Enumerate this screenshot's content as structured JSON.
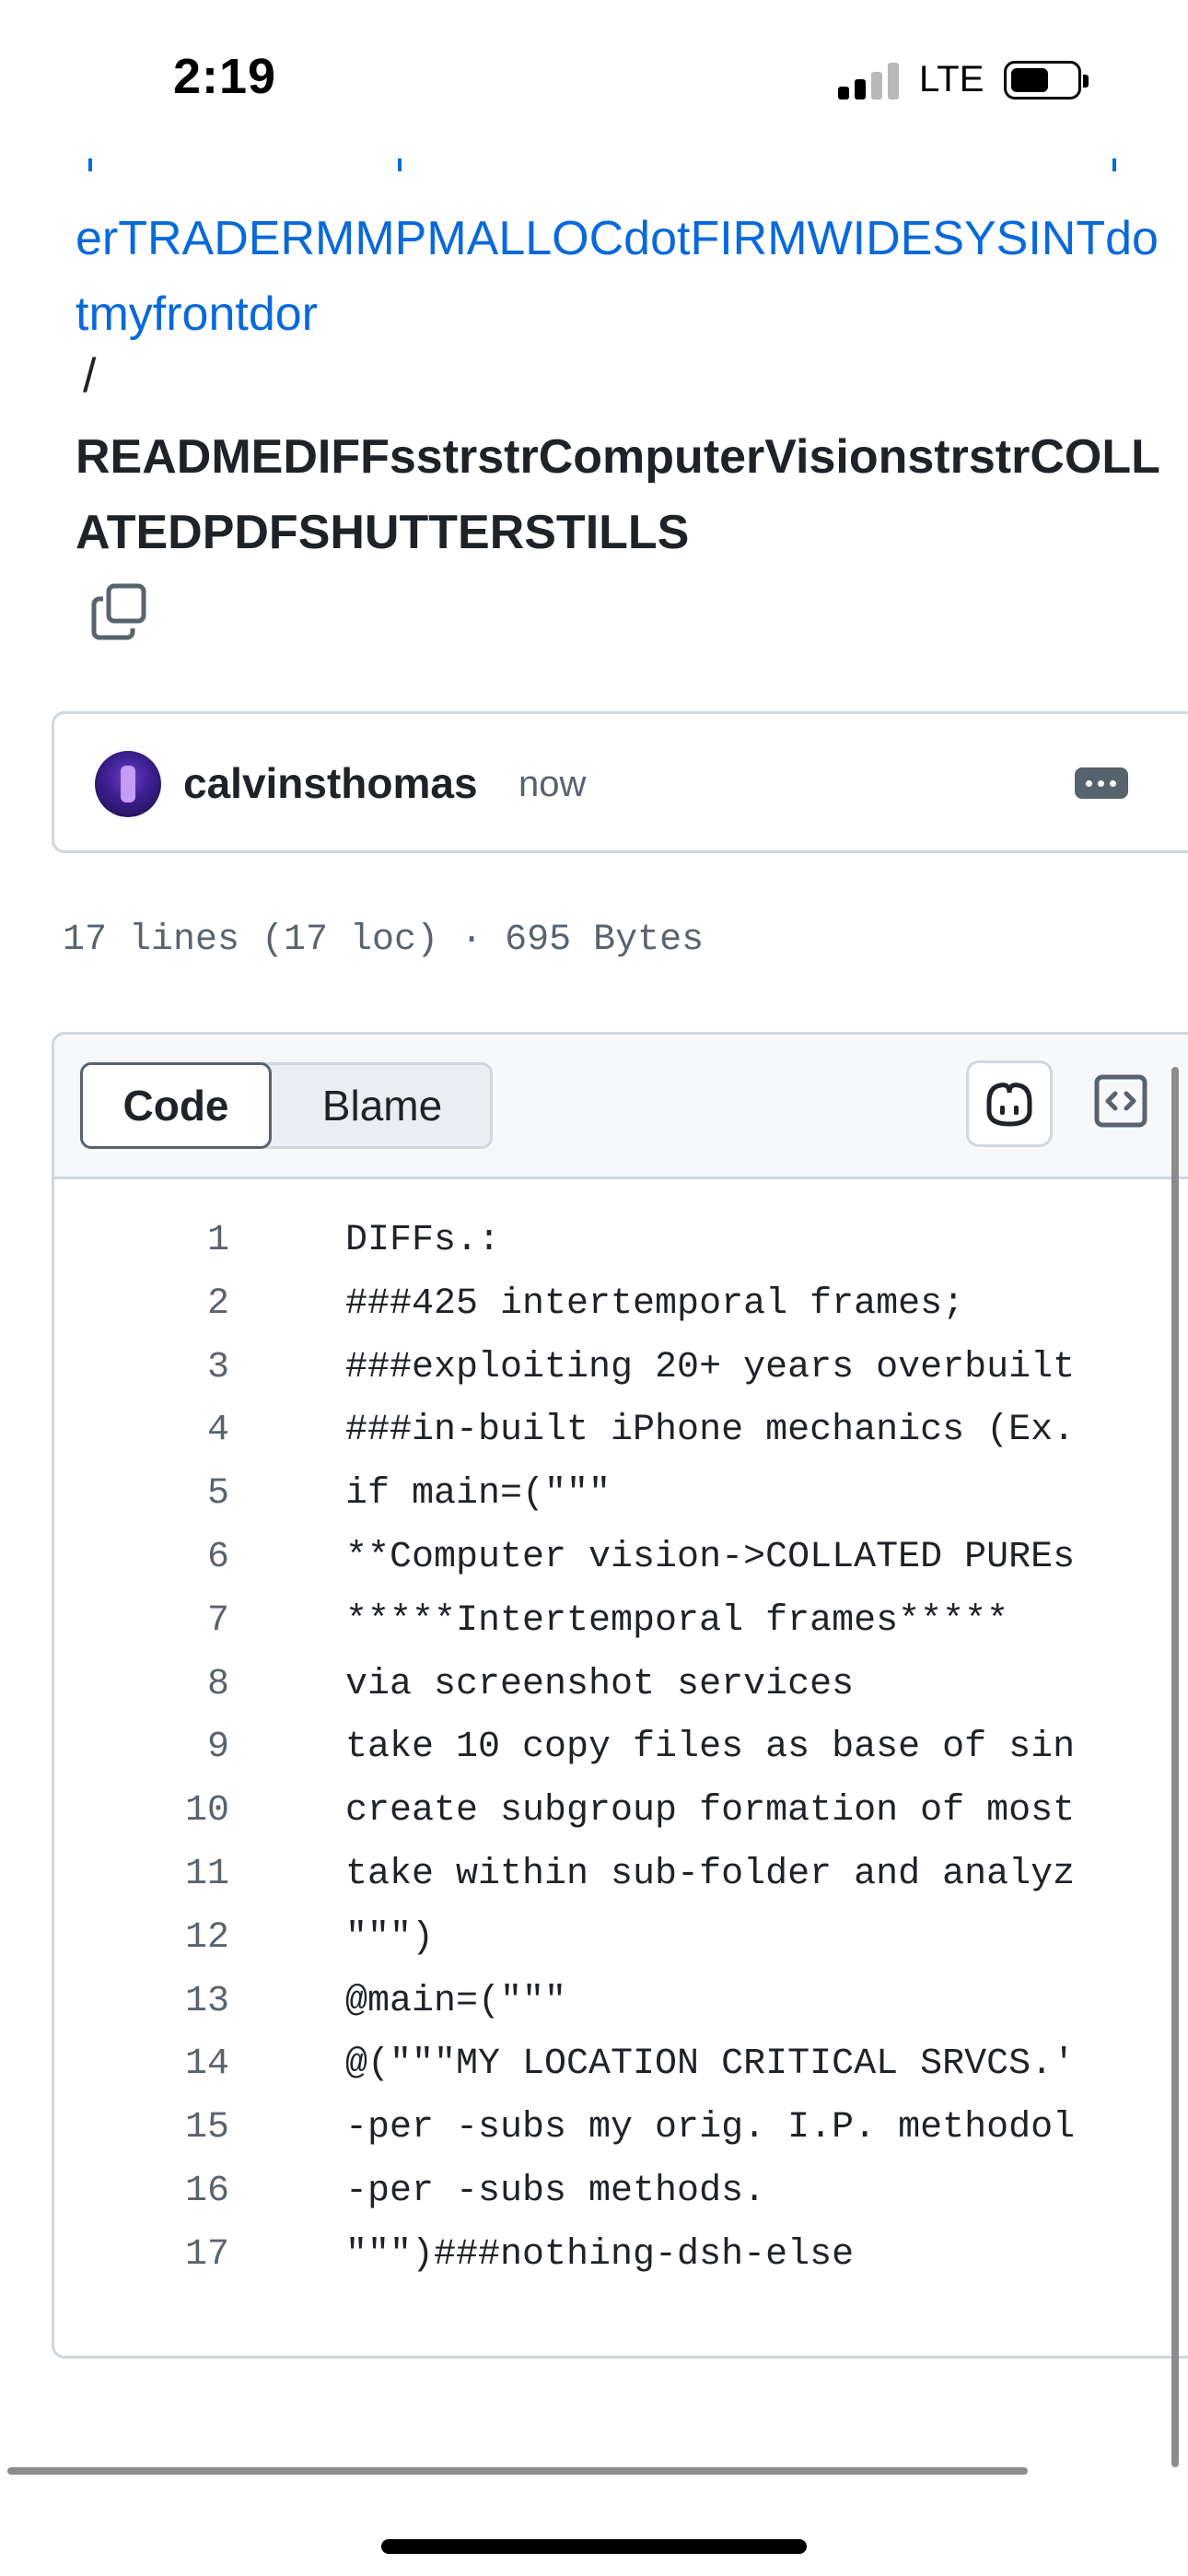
{
  "status_bar": {
    "time": "2:19",
    "network": "LTE"
  },
  "breadcrumb": {
    "repo_path": "erTRADERMMPMALLOCdotFIRMWIDESYSINTdotmyfrontdor",
    "separator": "/",
    "file_name": "READMEDIFFsstrstrComputerVisionstrstrCOLLATEDPDFSHUTTERSTILLS"
  },
  "commit": {
    "author": "calvinsthomas",
    "time": "now"
  },
  "file_meta": "17 lines (17 loc) · 695 Bytes",
  "code_view": {
    "tabs": [
      "Code",
      "Blame"
    ],
    "active_tab": "Code",
    "lines": [
      {
        "num": "1",
        "text": "DIFFs.:"
      },
      {
        "num": "2",
        "text": "###425 intertemporal frames;"
      },
      {
        "num": "3",
        "text": "###exploiting 20+ years overbuilt"
      },
      {
        "num": "4",
        "text": "###in-built iPhone mechanics (Ex."
      },
      {
        "num": "5",
        "text": "if main=(\"\"\""
      },
      {
        "num": "6",
        "text": "**Computer vision->COLLATED PUREs"
      },
      {
        "num": "7",
        "text": "*****Intertemporal frames*****"
      },
      {
        "num": "8",
        "text": "via screenshot services"
      },
      {
        "num": "9",
        "text": "take 10 copy files as base of sin"
      },
      {
        "num": "10",
        "text": "create subgroup formation of most"
      },
      {
        "num": "11",
        "text": "take within sub-folder and analyz"
      },
      {
        "num": "12",
        "text": "\"\"\")"
      },
      {
        "num": "13",
        "text": "@main=(\"\"\""
      },
      {
        "num": "14",
        "text": "@(\"\"\"MY LOCATION CRITICAL SRVCS.'"
      },
      {
        "num": "15",
        "text": "-per -subs my orig. I.P. methodol"
      },
      {
        "num": "16",
        "text": "-per -subs methods."
      },
      {
        "num": "17",
        "text": "\"\"\")###nothing-dsh-else"
      }
    ]
  },
  "colors": {
    "link": "#0969da",
    "text": "#1f2328",
    "muted": "#59636e",
    "border": "#d0d7de",
    "header_bg": "#f6f8fa"
  },
  "icons": [
    "copy-icon",
    "kebab-icon",
    "copilot-icon",
    "code-embed-icon"
  ]
}
